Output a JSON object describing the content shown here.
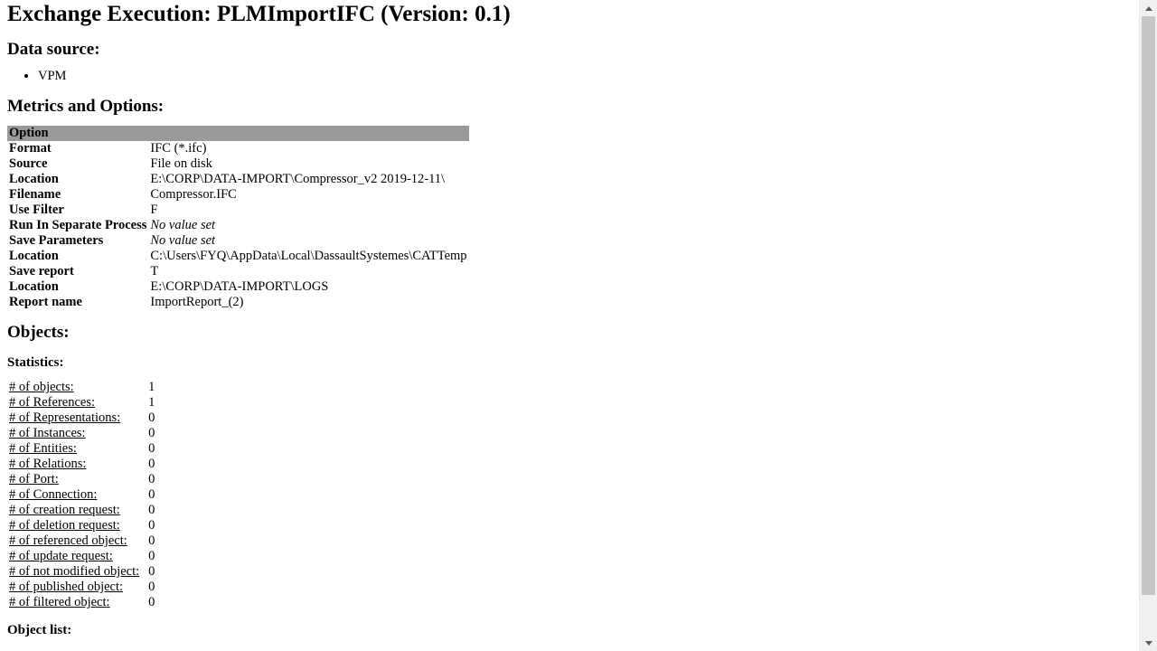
{
  "title": "Exchange Execution: PLMImportIFC (Version: 0.1)",
  "sections": {
    "data_source_heading": "Data source:",
    "metrics_heading": "Metrics and Options:",
    "objects_heading": "Objects:",
    "stats_heading": "Statistics:",
    "object_list_heading": "Object list:"
  },
  "data_source": {
    "items": [
      "VPM"
    ]
  },
  "options_header": "Option",
  "options": [
    {
      "k": "Format",
      "v": "IFC (*.ifc)"
    },
    {
      "k": "Source",
      "v": "File on disk"
    },
    {
      "k": "Location",
      "v": "E:\\CORP\\DATA-IMPORT\\Compressor_v2 2019-12-11\\"
    },
    {
      "k": "Filename",
      "v": "Compressor.IFC"
    },
    {
      "k": "Use Filter",
      "v": "F"
    },
    {
      "k": "Run In Separate Process",
      "v": "No value set",
      "noval": true
    },
    {
      "k": "Save Parameters",
      "v": "No value set",
      "noval": true
    },
    {
      "k": "Location",
      "v": "C:\\Users\\FYQ\\AppData\\Local\\DassaultSystemes\\CATTemp"
    },
    {
      "k": "Save report",
      "v": "T"
    },
    {
      "k": "Location",
      "v": "E:\\CORP\\DATA-IMPORT\\LOGS"
    },
    {
      "k": "Report name",
      "v": "ImportReport_(2)"
    }
  ],
  "stats": [
    {
      "k": "# of objects:",
      "v": "1"
    },
    {
      "k": "# of References:",
      "v": "1"
    },
    {
      "k": "# of Representations:",
      "v": "0"
    },
    {
      "k": "# of Instances:",
      "v": "0"
    },
    {
      "k": "# of Entities:",
      "v": "0"
    },
    {
      "k": "# of Relations:",
      "v": "0"
    },
    {
      "k": "# of Port:",
      "v": "0"
    },
    {
      "k": "# of Connection:",
      "v": "0"
    },
    {
      "k": "# of creation request:",
      "v": "0"
    },
    {
      "k": "# of deletion request:",
      "v": "0"
    },
    {
      "k": "# of referenced object:",
      "v": "0"
    },
    {
      "k": "# of update request:",
      "v": "0"
    },
    {
      "k": "# of not modified object:",
      "v": "0"
    },
    {
      "k": "# of published object:",
      "v": "0"
    },
    {
      "k": "# of filtered object:",
      "v": "0"
    }
  ]
}
